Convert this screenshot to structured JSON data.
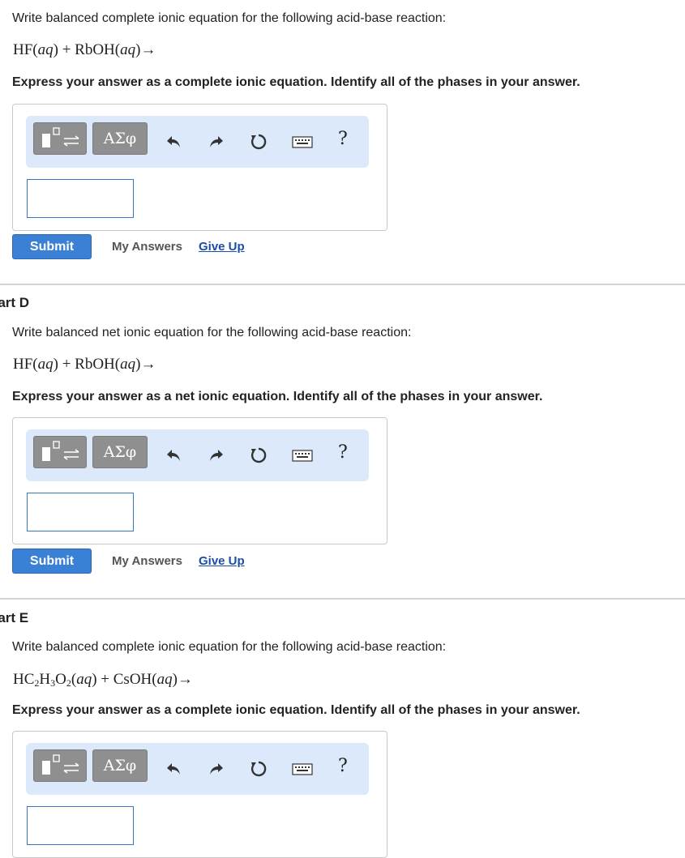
{
  "part_c": {
    "prompt": "Write balanced complete ionic equation for the following acid-base reaction:",
    "instruction": "Express your answer as a complete ionic equation. Identify all of the phases in your answer.",
    "submit": "Submit",
    "my_answers": "My Answers",
    "give_up": "Give Up"
  },
  "part_d": {
    "label": "Part D",
    "prompt": "Write balanced net ionic equation for the following acid-base reaction:",
    "instruction": "Express your answer as a net ionic equation. Identify all of the phases in your answer.",
    "submit": "Submit",
    "my_answers": "My Answers",
    "give_up": "Give Up"
  },
  "part_e": {
    "label": "Part E",
    "prompt": "Write balanced complete ionic equation for the following acid-base reaction:",
    "instruction": "Express your answer as a complete ionic equation. Identify all of the phases in your answer."
  },
  "toolbar": {
    "greek_label": "ΑΣφ",
    "help_label": "?",
    "icons": [
      "templates-icon",
      "undo-icon",
      "redo-icon",
      "reset-icon",
      "keyboard-icon",
      "help-icon"
    ]
  },
  "colors": {
    "toolbar_bg": "#dce9fb",
    "button_gray": "#8f8f8f",
    "submit_blue": "#3a80d4",
    "link_blue": "#1a4ea8",
    "input_border": "#3a75c4"
  }
}
